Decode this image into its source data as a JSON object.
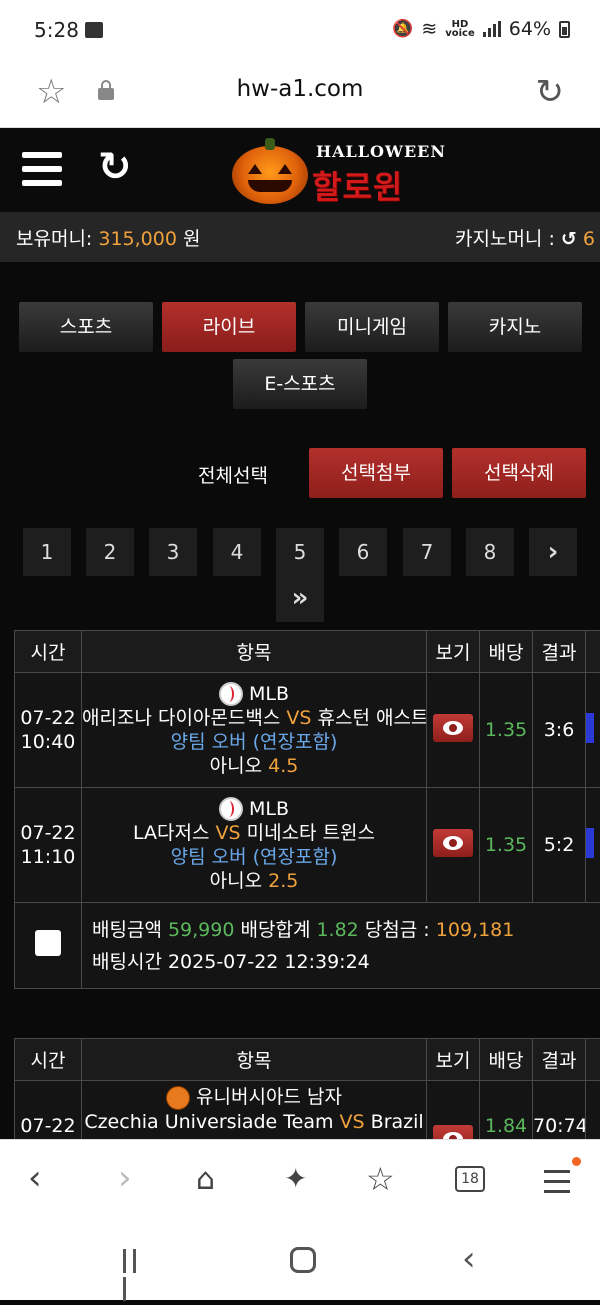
{
  "status": {
    "time": "5:28",
    "battery": "64%",
    "hd": "HD\nvoice"
  },
  "browser": {
    "url": "hw-a1.com"
  },
  "site": {
    "logo_top": "HALLOWEEN",
    "logo_main": "할로윈"
  },
  "money": {
    "label": "보유머니:",
    "amount": "315,000",
    "unit": "원",
    "casino_label": "카지노머니 :",
    "casino_value": "6"
  },
  "tabs": [
    {
      "label": "스포츠",
      "active": false
    },
    {
      "label": "라이브",
      "active": true
    },
    {
      "label": "미니게임",
      "active": false
    },
    {
      "label": "카지노",
      "active": false
    },
    {
      "label": "E-스포츠",
      "active": false
    }
  ],
  "selection": {
    "select_all": "전체선택",
    "attach": "선택첨부",
    "delete": "선택삭제"
  },
  "pagination": {
    "pages": [
      "1",
      "2",
      "3",
      "4",
      "5",
      "6",
      "7",
      "8"
    ],
    "next": "›",
    "last": "»"
  },
  "table_headers": {
    "time": "시간",
    "item": "항목",
    "view": "보기",
    "odds": "배당",
    "result": "결과"
  },
  "bets": [
    {
      "matches": [
        {
          "date": "07-22",
          "time": "10:40",
          "league": "MLB",
          "home": "애리조나 다이아몬드백스",
          "vs": "VS",
          "away": "휴스턴 애스트로스",
          "market": "양팀 오버 (연장포함)",
          "pick": "아니오",
          "line": "4.5",
          "odds": "1.35",
          "result": "3:6"
        },
        {
          "date": "07-22",
          "time": "11:10",
          "league": "MLB",
          "home": "LA다저스",
          "vs": "VS",
          "away": "미네소타 트윈스",
          "market": "양팀 오버 (연장포함)",
          "pick": "아니오",
          "line": "2.5",
          "odds": "1.35",
          "result": "5:2"
        }
      ],
      "summary": {
        "stake_label": "배팅금액",
        "stake": "59,990",
        "total_odds_label": "배당합계",
        "total_odds": "1.82",
        "win_label": "당첨금 :",
        "win": "109,181",
        "time_label": "배팅시간",
        "time": "2025-07-22 12:39:24"
      }
    },
    {
      "matches": [
        {
          "date": "07-22",
          "time": "",
          "league": "유니버시아드 남자",
          "home": "Czechia Universiade Team",
          "vs": "VS",
          "away": "Brazil",
          "odds": "1.84",
          "result": "70:74"
        }
      ]
    }
  ],
  "bottom_nav": {
    "tab_count": "18"
  }
}
